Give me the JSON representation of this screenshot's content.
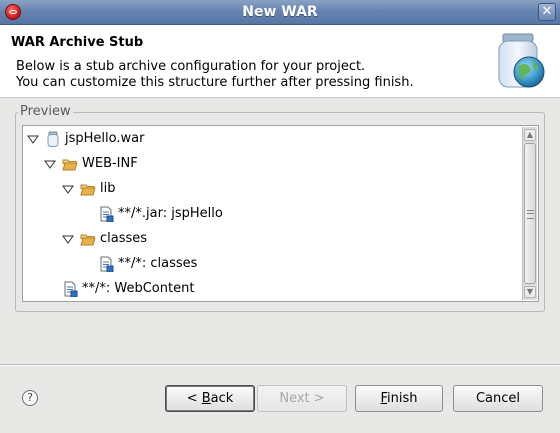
{
  "window": {
    "title": "New WAR"
  },
  "header": {
    "title": "WAR Archive Stub",
    "line1": "Below is a stub archive configuration for your project.",
    "line2": "You can customize this structure further after pressing finish."
  },
  "preview": {
    "label": "Preview",
    "nodes": [
      {
        "label": "jspHello.war",
        "icon": "jar-archive-icon",
        "expanded": true
      },
      {
        "label": "WEB-INF",
        "icon": "folder-open-icon",
        "expanded": true
      },
      {
        "label": "lib",
        "icon": "folder-open-icon",
        "expanded": true
      },
      {
        "label": "**/*.jar: jspHello",
        "icon": "fileset-icon"
      },
      {
        "label": "classes",
        "icon": "folder-open-icon",
        "expanded": true
      },
      {
        "label": "**/*: classes",
        "icon": "fileset-icon"
      },
      {
        "label": "**/*: WebContent",
        "icon": "fileset-icon"
      }
    ]
  },
  "buttons": {
    "back": {
      "mnemonic": "B",
      "rest": "ack",
      "prefix": "< "
    },
    "next": {
      "label": "Next >",
      "enabled": false
    },
    "finish": {
      "mnemonic": "F",
      "rest": "inish"
    },
    "cancel": {
      "label": "Cancel"
    }
  },
  "colors": {
    "titlebar": "#6784b1",
    "folder": "#e9b04a",
    "dialog_bg": "#e8e8e7"
  }
}
